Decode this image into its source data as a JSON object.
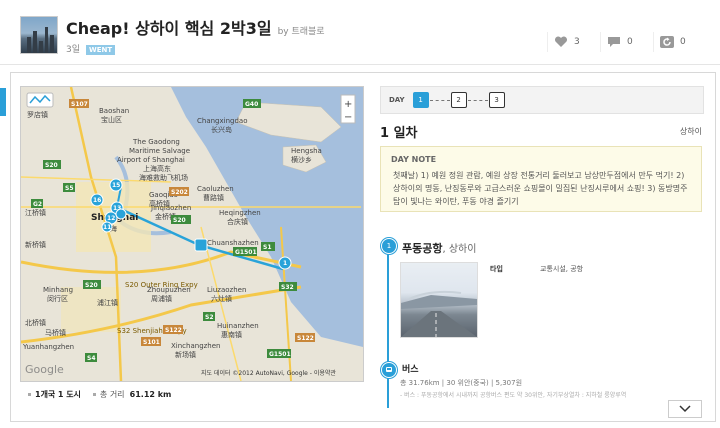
{
  "header": {
    "title": "Cheap! 상하이 핵심 2박3일",
    "by": "by 트래블로",
    "days": "3일",
    "badge": "WENT",
    "likes": "3",
    "comments": "0",
    "shares": "0"
  },
  "map": {
    "labels": {
      "baoshan_en": "Baoshan",
      "baoshan_cn": "宝山区",
      "gaodong_1": "The Gaodong",
      "gaodong_2": "Maritime Salvage",
      "gaodong_3": "Airport of Shanghai",
      "gaodong_4": "上海高东",
      "gaodong_5": "海难救助飞机场",
      "changxing_en": "Changxingdao",
      "changxing_cn": "长兴岛",
      "hengsha_en": "Hengsha",
      "hengsha_cn": "横沙乡",
      "gaoqiao_en": "Gaoqiao",
      "gaoqiao_cn": "高桥镇",
      "jinqiao_en": "Jinqiaozhen",
      "jinqiao_cn": "金桥镇",
      "caoluzhen_en": "Caoluzhen",
      "caoluzhen_cn": "曹路镇",
      "heqingzhen_en": "Heqingzhen",
      "heqingzhen_cn": "合庆镇",
      "chuanshazhen": "Chuanshazhen",
      "s20ring": "S20 Outer Ring Expy",
      "minhang_en": "Minhang",
      "minhang_cn": "闵行区",
      "zhoupu_en": "Zhoupuzhen",
      "zhoupu_cn": "周浦镇",
      "liuzao_en": "Liuzaozhen",
      "liuzao_cn": "六灶镇",
      "s32": "S32 Shenjiahu Expy",
      "huinan_en": "Huinanzhen",
      "huinan_cn": "惠南镇",
      "xinchang_en": "Xinchangzhen",
      "xinchang_cn": "新场镇",
      "luozhen": "罗店镇",
      "jiangqiao": "江桥镇",
      "beiqiao": "北桥镇",
      "pujiang": "浦江镇",
      "xinqiao": "新桥镇",
      "maqiao": "马桥镇",
      "shanghai": "Shanghai",
      "shanghai_cn": "上海",
      "nanshanzhen": "Yuanhangzhen"
    },
    "roads": [
      "S107",
      "G40",
      "S20",
      "S5",
      "S20",
      "G2",
      "S202",
      "S1",
      "G1501",
      "S32",
      "S2",
      "S122",
      "S4",
      "S101",
      "G1501",
      "S122",
      "S20"
    ],
    "markers": [
      "15",
      "16",
      "13",
      "12",
      "11",
      "1"
    ],
    "attribution": "지도 데이터 ©2012 AutoNavi, Google - 이용약관",
    "zoom_in": "+",
    "zoom_out": "−",
    "watermark": "Google"
  },
  "map_footer": {
    "countries_label": "1개국",
    "cities_label": "1 도시",
    "distance_label": "총 거리",
    "distance_value": "61.12 km"
  },
  "itinerary": {
    "day_label": "DAY",
    "days": [
      "1",
      "2",
      "3"
    ],
    "day_heading": "1 일차",
    "city": "상하이",
    "note_title": "DAY NOTE",
    "note_text": "첫째날) 1) 예원 정원 관람, 예원 상장 전통거리 둘러보고 남상만두점에서 만두 먹기! 2) 상하이의 명동, 난징동루와 고급스러운 쇼핑몰이 밀집된 난징시루에서 쇼핑! 3) 동방명주 탑이 빛나는 와이탄, 푸동 야경 즐기기",
    "place_num": "1",
    "place_name": "푸동공항",
    "place_city": ", 상하이",
    "type_label": "타입",
    "type_value": "교통시설, 공항",
    "transport_name": "버스",
    "transport_info": "총 31.76km  |  30 위안(중국)  |  5,307원",
    "transport_sub": "- 버스 : 푸동공항에서 시내까지 공항버스 편도 약 30위안, 자기부상열차 : 지하철 룽양루역"
  },
  "colors": {
    "accent": "#2a9fd8",
    "note_bg": "#fdfbe8"
  }
}
